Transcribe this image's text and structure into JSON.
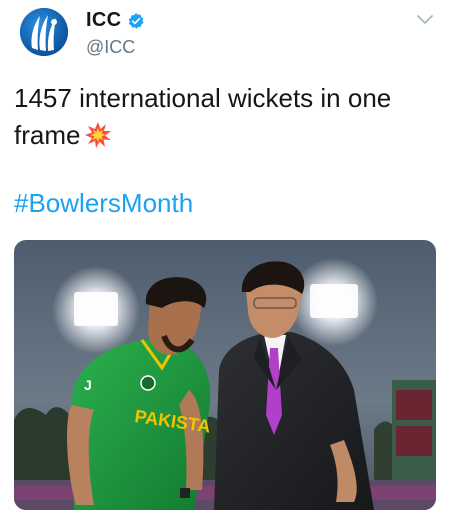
{
  "tweet": {
    "display_name": "ICC",
    "handle": "@ICC",
    "text": "1457 international wickets in one frame",
    "hashtag": "#BowlersMonth",
    "emoji": "collision-emoji",
    "avatar_icon": "icc-logo-icon",
    "verified_icon": "verified-badge-icon",
    "menu_icon": "chevron-down-icon"
  },
  "media": {
    "jersey_text": "PAKISTA",
    "jersey_logo": "J"
  },
  "colors": {
    "link": "#1da1f2",
    "verified": "#1da1f2",
    "text": "#14171a",
    "secondary": "#657786",
    "jersey": "#1f9a3f",
    "tie": "#b040c8"
  }
}
